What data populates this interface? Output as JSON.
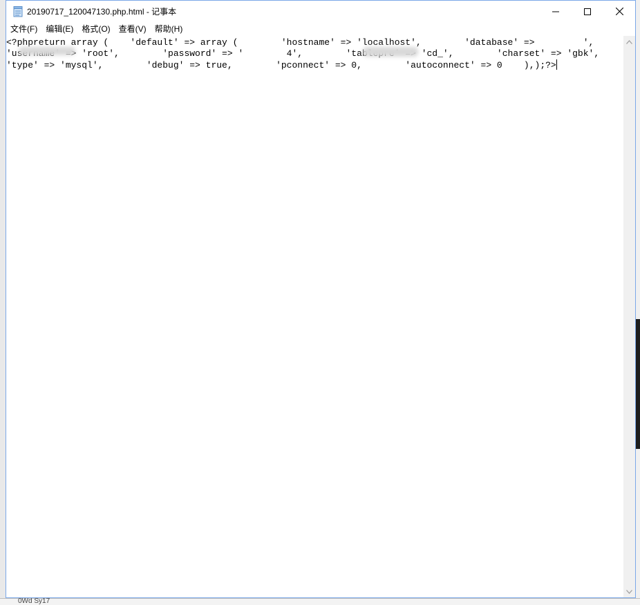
{
  "window": {
    "title": "20190717_120047130.php.html - 记事本"
  },
  "menu": {
    "items": [
      "文件(F)",
      "编辑(E)",
      "格式(O)",
      "查看(V)",
      "帮助(H)"
    ]
  },
  "editor": {
    "content": "<?phpreturn array (    'default' => array (        'hostname' => 'localhost',        'database' =>         ',        'username' => 'root',        'password' => '        4',        'tablepre' => 'cd_',        'charset' => 'gbk',        'type' => 'mysql',        'debug' => true,        'pconnect' => 0,        'autoconnect' => 0    ),);?>"
  },
  "background": {
    "bottom_text": "0Wd Sy17"
  },
  "colors": {
    "window_border": "#7aa7e8",
    "scrollbar": "#f0f0f0",
    "text": "#000000"
  }
}
